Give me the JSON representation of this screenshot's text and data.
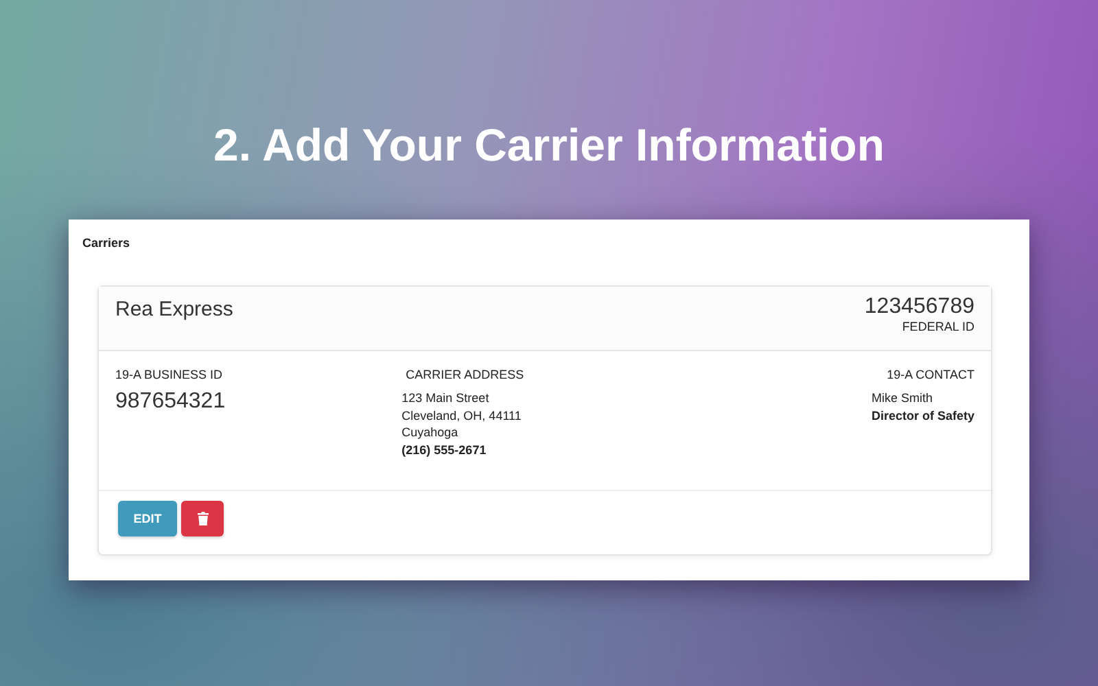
{
  "headline": "2. Add Your Carrier Information",
  "panel": {
    "title": "Carriers"
  },
  "carrier": {
    "name": "Rea Express",
    "federal_id": "123456789",
    "federal_id_label": "FEDERAL ID",
    "business_id_label": "19-A BUSINESS ID",
    "business_id": "987654321",
    "address_label": "CARRIER ADDRESS",
    "address_lines": [
      {
        "text": "123 Main Street",
        "bold": false
      },
      {
        "text": "Cleveland, OH, 44111",
        "bold": false
      },
      {
        "text": "Cuyahoga",
        "bold": false
      },
      {
        "text": "(216) 555-2671",
        "bold": true
      }
    ],
    "contact_label": "19-A CONTACT",
    "contact_lines": [
      {
        "text": "Mike Smith",
        "bold": false
      },
      {
        "text": "Director of Safety",
        "bold": true
      }
    ]
  },
  "actions": [
    {
      "kind": "edit",
      "label": "EDIT"
    },
    {
      "kind": "delete"
    }
  ]
}
